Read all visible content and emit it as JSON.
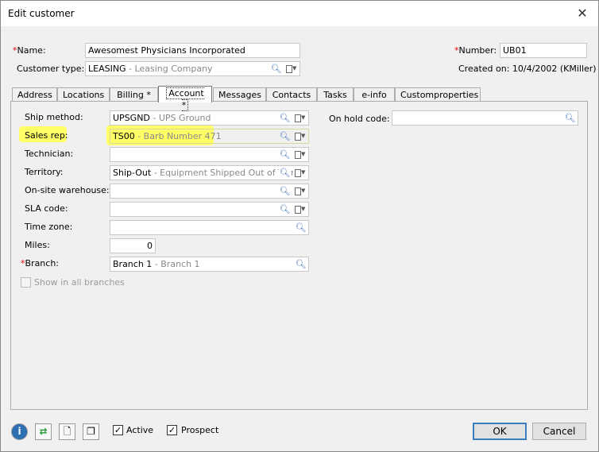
{
  "window": {
    "title": "Edit customer",
    "close_icon": "close-icon"
  },
  "header": {
    "name_label": "Name:",
    "name_value": "Awesomest Physicians Incorporated",
    "customer_type_label": "Customer type:",
    "customer_type_code": "LEASING",
    "customer_type_desc": " - Leasing Company",
    "number_label": "Number:",
    "number_value": "UB01",
    "created_on": "Created on: 10/4/2002 (KMiller)",
    "required_mark": "*"
  },
  "tabs": [
    {
      "label": "Address"
    },
    {
      "label": "Locations"
    },
    {
      "label": "Billing  *"
    },
    {
      "label": "Account *"
    },
    {
      "label": "Messages"
    },
    {
      "label": "Contacts"
    },
    {
      "label": "Tasks"
    },
    {
      "label": "e-info"
    },
    {
      "label": "Customproperties"
    }
  ],
  "account": {
    "ship_method": {
      "label": "Ship method:",
      "code": "UPSGND",
      "desc": " - UPS Ground"
    },
    "sales_rep": {
      "label": "Sales rep:",
      "code": "TS00",
      "desc": " - Barb Number 471"
    },
    "technician": {
      "label": "Technician:",
      "value": ""
    },
    "territory": {
      "label": "Territory:",
      "code": "Ship-Out",
      "desc": " - Equipment Shipped Out of Territo"
    },
    "onsite_warehouse": {
      "label": "On-site warehouse:",
      "value": ""
    },
    "sla_code": {
      "label": "SLA code:",
      "value": ""
    },
    "time_zone": {
      "label": "Time zone:",
      "value": ""
    },
    "miles": {
      "label": "Miles:",
      "value": "0"
    },
    "branch": {
      "label": "Branch:",
      "code": "Branch 1",
      "desc": " - Branch 1"
    },
    "show_all_branches": {
      "label": "Show in all branches",
      "checked": false
    },
    "on_hold_code": {
      "label": "On hold code:",
      "value": ""
    },
    "highlight_color": "#ffff66"
  },
  "footer": {
    "active_label": "Active",
    "active_checked": true,
    "prospect_label": "Prospect",
    "prospect_checked": true,
    "ok_label": "OK",
    "cancel_label": "Cancel",
    "check_mark": "✓",
    "toolbar_icons": [
      "info-icon",
      "swap-arrows-icon",
      "document-icon",
      "copy-documents-icon"
    ]
  },
  "colors": {
    "accent": "#3c7fc1",
    "required": "#e00000"
  }
}
